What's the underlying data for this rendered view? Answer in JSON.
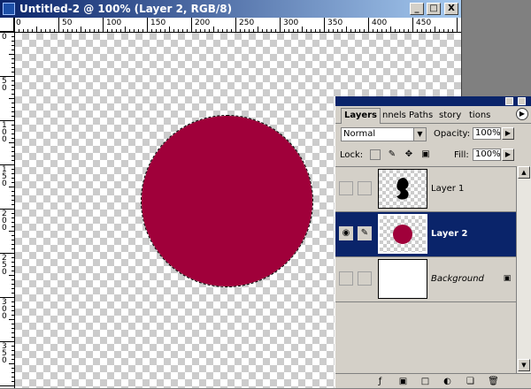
{
  "window": {
    "title": "Untitled-2 @ 100% (Layer 2, RGB/8)",
    "minimize_label": "_",
    "maximize_label": "□",
    "close_label": "X"
  },
  "ruler": {
    "top_labels": [
      "0",
      "50",
      "100",
      "150",
      "200",
      "250",
      "300",
      "350",
      "400",
      "450"
    ],
    "left_labels": [
      "0",
      "50",
      "100",
      "150",
      "200",
      "250",
      "300",
      "350"
    ]
  },
  "canvas": {
    "shape_color": "#a0003a"
  },
  "layers_panel": {
    "tabs": [
      "Layers",
      "nnels",
      "Paths",
      "story",
      "tions"
    ],
    "blend_mode": "Normal",
    "opacity_label": "Opacity:",
    "opacity_value": "100%",
    "lock_label": "Lock:",
    "fill_label": "Fill:",
    "fill_value": "100%",
    "layers": [
      {
        "name": "Layer 1",
        "visible": false,
        "selected": false
      },
      {
        "name": "Layer 2",
        "visible": true,
        "selected": true
      },
      {
        "name": "Background",
        "visible": false,
        "selected": false
      }
    ]
  }
}
